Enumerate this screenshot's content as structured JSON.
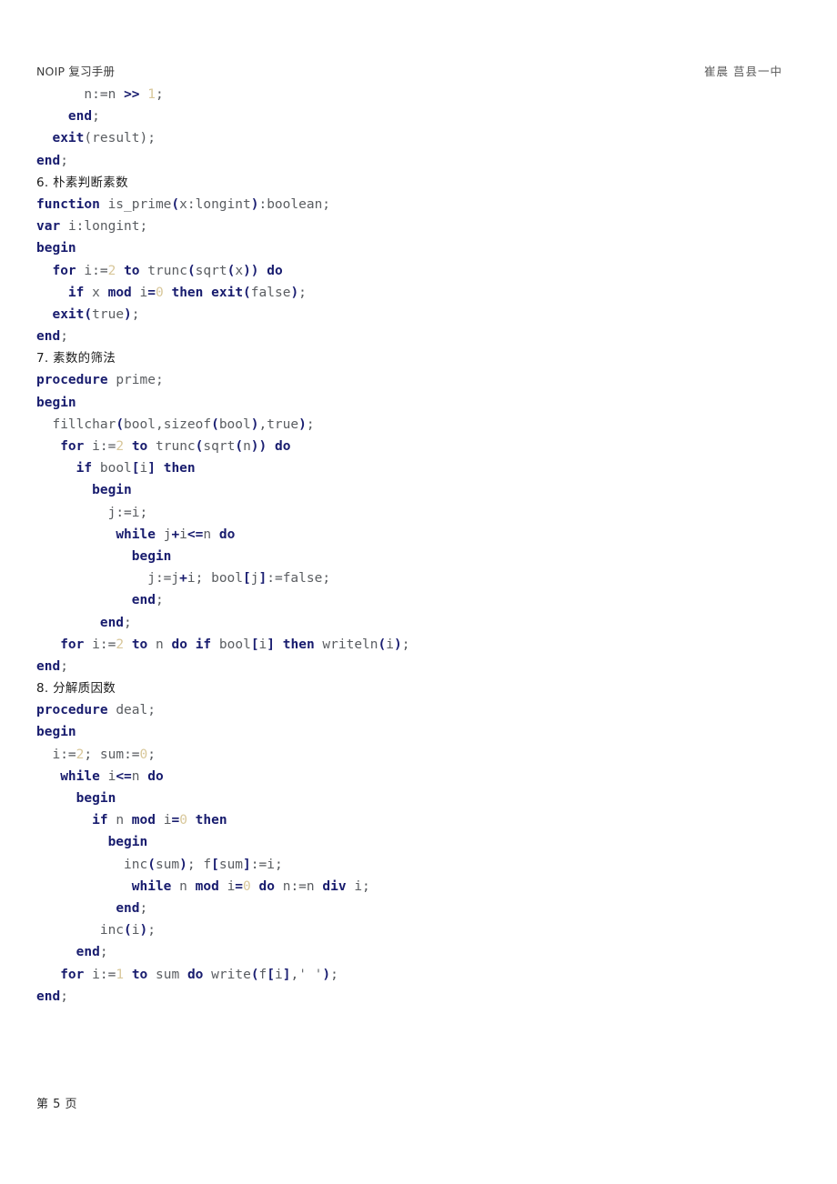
{
  "document": {
    "header_left": "NOIP 复习手册",
    "header_right": "崔晨  莒县一中",
    "footer": "第 5 页"
  },
  "code_lines": [
    {
      "indent": 6,
      "tokens": [
        {
          "t": "n",
          "c": "id"
        },
        {
          "t": ":=",
          "c": "punc"
        },
        {
          "t": "n",
          "c": "id"
        },
        {
          "t": " ",
          "c": "punc"
        },
        {
          "t": ">>",
          "c": "op"
        },
        {
          "t": " ",
          "c": "punc"
        },
        {
          "t": "1",
          "c": "num"
        },
        {
          "t": ";",
          "c": "punc"
        }
      ]
    },
    {
      "indent": 4,
      "tokens": [
        {
          "t": "end",
          "c": "kw"
        },
        {
          "t": ";",
          "c": "punc"
        }
      ]
    },
    {
      "indent": 2,
      "tokens": [
        {
          "t": "exit",
          "c": "kw"
        },
        {
          "t": "(",
          "c": "punc"
        },
        {
          "t": "result",
          "c": "id"
        },
        {
          "t": ")",
          "c": "punc"
        },
        {
          "t": ";",
          "c": "punc"
        }
      ]
    },
    {
      "indent": 0,
      "tokens": [
        {
          "t": "end",
          "c": "kw"
        },
        {
          "t": ";",
          "c": "punc"
        }
      ]
    },
    {
      "heading": true,
      "indent": 0,
      "text": "6. 朴素判断素数"
    },
    {
      "indent": 0,
      "tokens": [
        {
          "t": "function",
          "c": "kw"
        },
        {
          "t": " ",
          "c": "punc"
        },
        {
          "t": "is_prime",
          "c": "id"
        },
        {
          "t": "(",
          "c": "brk"
        },
        {
          "t": "x:longint",
          "c": "id"
        },
        {
          "t": ")",
          "c": "brk"
        },
        {
          "t": ":boolean;",
          "c": "id"
        }
      ]
    },
    {
      "indent": 0,
      "tokens": [
        {
          "t": "var",
          "c": "kw"
        },
        {
          "t": " ",
          "c": "punc"
        },
        {
          "t": "i:longint;",
          "c": "id"
        }
      ]
    },
    {
      "indent": 0,
      "tokens": [
        {
          "t": "begin",
          "c": "kw"
        }
      ]
    },
    {
      "indent": 2,
      "tokens": [
        {
          "t": "for",
          "c": "kw"
        },
        {
          "t": " ",
          "c": "punc"
        },
        {
          "t": "i",
          "c": "id"
        },
        {
          "t": ":=",
          "c": "punc"
        },
        {
          "t": "2",
          "c": "num"
        },
        {
          "t": " ",
          "c": "punc"
        },
        {
          "t": "to",
          "c": "kw"
        },
        {
          "t": " ",
          "c": "punc"
        },
        {
          "t": "trunc",
          "c": "id"
        },
        {
          "t": "(",
          "c": "brk"
        },
        {
          "t": "sqrt",
          "c": "id"
        },
        {
          "t": "(",
          "c": "brk"
        },
        {
          "t": "x",
          "c": "id"
        },
        {
          "t": ")",
          "c": "brk"
        },
        {
          "t": ")",
          "c": "brk"
        },
        {
          "t": " ",
          "c": "punc"
        },
        {
          "t": "do",
          "c": "kw"
        }
      ]
    },
    {
      "indent": 4,
      "tokens": [
        {
          "t": "if",
          "c": "kw"
        },
        {
          "t": " ",
          "c": "punc"
        },
        {
          "t": "x",
          "c": "id"
        },
        {
          "t": " ",
          "c": "punc"
        },
        {
          "t": "mod",
          "c": "kw"
        },
        {
          "t": " ",
          "c": "punc"
        },
        {
          "t": "i",
          "c": "id"
        },
        {
          "t": "=",
          "c": "op"
        },
        {
          "t": "0",
          "c": "num"
        },
        {
          "t": " ",
          "c": "punc"
        },
        {
          "t": "then",
          "c": "kw"
        },
        {
          "t": " ",
          "c": "punc"
        },
        {
          "t": "exit",
          "c": "kw"
        },
        {
          "t": "(",
          "c": "brk"
        },
        {
          "t": "false",
          "c": "id"
        },
        {
          "t": ")",
          "c": "brk"
        },
        {
          "t": ";",
          "c": "punc"
        }
      ]
    },
    {
      "indent": 2,
      "tokens": [
        {
          "t": "exit",
          "c": "kw"
        },
        {
          "t": "(",
          "c": "brk"
        },
        {
          "t": "true",
          "c": "id"
        },
        {
          "t": ")",
          "c": "brk"
        },
        {
          "t": ";",
          "c": "punc"
        }
      ]
    },
    {
      "indent": 0,
      "tokens": [
        {
          "t": "end",
          "c": "kw"
        },
        {
          "t": ";",
          "c": "punc"
        }
      ]
    },
    {
      "heading": true,
      "indent": 0,
      "text": "7. 素数的筛法"
    },
    {
      "indent": 0,
      "tokens": [
        {
          "t": "procedure",
          "c": "kw"
        },
        {
          "t": " ",
          "c": "punc"
        },
        {
          "t": "prime;",
          "c": "id"
        }
      ]
    },
    {
      "indent": 0,
      "tokens": [
        {
          "t": "begin",
          "c": "kw"
        }
      ]
    },
    {
      "indent": 2,
      "tokens": [
        {
          "t": "fillchar",
          "c": "id"
        },
        {
          "t": "(",
          "c": "brk"
        },
        {
          "t": "bool,sizeof",
          "c": "id"
        },
        {
          "t": "(",
          "c": "brk"
        },
        {
          "t": "bool",
          "c": "id"
        },
        {
          "t": ")",
          "c": "brk"
        },
        {
          "t": ",",
          "c": "punc"
        },
        {
          "t": "true",
          "c": "id"
        },
        {
          "t": ")",
          "c": "brk"
        },
        {
          "t": ";",
          "c": "punc"
        }
      ]
    },
    {
      "indent": 3,
      "tokens": [
        {
          "t": "for",
          "c": "kw"
        },
        {
          "t": " ",
          "c": "punc"
        },
        {
          "t": "i",
          "c": "id"
        },
        {
          "t": ":=",
          "c": "punc"
        },
        {
          "t": "2",
          "c": "num"
        },
        {
          "t": " ",
          "c": "punc"
        },
        {
          "t": "to",
          "c": "kw"
        },
        {
          "t": " ",
          "c": "punc"
        },
        {
          "t": "trunc",
          "c": "id"
        },
        {
          "t": "(",
          "c": "brk"
        },
        {
          "t": "sqrt",
          "c": "id"
        },
        {
          "t": "(",
          "c": "brk"
        },
        {
          "t": "n",
          "c": "id"
        },
        {
          "t": ")",
          "c": "brk"
        },
        {
          "t": ")",
          "c": "brk"
        },
        {
          "t": " ",
          "c": "punc"
        },
        {
          "t": "do",
          "c": "kw"
        }
      ]
    },
    {
      "indent": 5,
      "tokens": [
        {
          "t": "if",
          "c": "kw"
        },
        {
          "t": " ",
          "c": "punc"
        },
        {
          "t": "bool",
          "c": "id"
        },
        {
          "t": "[",
          "c": "brk"
        },
        {
          "t": "i",
          "c": "id"
        },
        {
          "t": "]",
          "c": "brk"
        },
        {
          "t": " ",
          "c": "punc"
        },
        {
          "t": "then",
          "c": "kw"
        }
      ]
    },
    {
      "indent": 7,
      "tokens": [
        {
          "t": "begin",
          "c": "kw"
        }
      ]
    },
    {
      "indent": 9,
      "tokens": [
        {
          "t": "j",
          "c": "id"
        },
        {
          "t": ":=",
          "c": "punc"
        },
        {
          "t": "i",
          "c": "id"
        },
        {
          "t": ";",
          "c": "punc"
        }
      ]
    },
    {
      "indent": 10,
      "tokens": [
        {
          "t": "while",
          "c": "kw"
        },
        {
          "t": " ",
          "c": "punc"
        },
        {
          "t": "j",
          "c": "id"
        },
        {
          "t": "+",
          "c": "op"
        },
        {
          "t": "i",
          "c": "id"
        },
        {
          "t": "<=",
          "c": "op"
        },
        {
          "t": "n",
          "c": "id"
        },
        {
          "t": " ",
          "c": "punc"
        },
        {
          "t": "do",
          "c": "kw"
        }
      ]
    },
    {
      "indent": 12,
      "tokens": [
        {
          "t": "begin",
          "c": "kw"
        }
      ]
    },
    {
      "indent": 14,
      "tokens": [
        {
          "t": "j",
          "c": "id"
        },
        {
          "t": ":=",
          "c": "punc"
        },
        {
          "t": "j",
          "c": "id"
        },
        {
          "t": "+",
          "c": "op"
        },
        {
          "t": "i",
          "c": "id"
        },
        {
          "t": ";",
          "c": "punc"
        },
        {
          "t": " ",
          "c": "punc"
        },
        {
          "t": "bool",
          "c": "id"
        },
        {
          "t": "[",
          "c": "brk"
        },
        {
          "t": "j",
          "c": "id"
        },
        {
          "t": "]",
          "c": "brk"
        },
        {
          "t": ":=",
          "c": "punc"
        },
        {
          "t": "false",
          "c": "id"
        },
        {
          "t": ";",
          "c": "punc"
        }
      ]
    },
    {
      "indent": 12,
      "tokens": [
        {
          "t": "end",
          "c": "kw"
        },
        {
          "t": ";",
          "c": "punc"
        }
      ]
    },
    {
      "indent": 8,
      "tokens": [
        {
          "t": "end",
          "c": "kw"
        },
        {
          "t": ";",
          "c": "punc"
        }
      ]
    },
    {
      "indent": 3,
      "tokens": [
        {
          "t": "for",
          "c": "kw"
        },
        {
          "t": " ",
          "c": "punc"
        },
        {
          "t": "i",
          "c": "id"
        },
        {
          "t": ":=",
          "c": "punc"
        },
        {
          "t": "2",
          "c": "num"
        },
        {
          "t": " ",
          "c": "punc"
        },
        {
          "t": "to",
          "c": "kw"
        },
        {
          "t": " ",
          "c": "punc"
        },
        {
          "t": "n",
          "c": "id"
        },
        {
          "t": " ",
          "c": "punc"
        },
        {
          "t": "do",
          "c": "kw"
        },
        {
          "t": " ",
          "c": "punc"
        },
        {
          "t": "if",
          "c": "kw"
        },
        {
          "t": " ",
          "c": "punc"
        },
        {
          "t": "bool",
          "c": "id"
        },
        {
          "t": "[",
          "c": "brk"
        },
        {
          "t": "i",
          "c": "id"
        },
        {
          "t": "]",
          "c": "brk"
        },
        {
          "t": " ",
          "c": "punc"
        },
        {
          "t": "then",
          "c": "kw"
        },
        {
          "t": " ",
          "c": "punc"
        },
        {
          "t": "writeln",
          "c": "id"
        },
        {
          "t": "(",
          "c": "brk"
        },
        {
          "t": "i",
          "c": "id"
        },
        {
          "t": ")",
          "c": "brk"
        },
        {
          "t": ";",
          "c": "punc"
        }
      ]
    },
    {
      "indent": 0,
      "tokens": [
        {
          "t": "end",
          "c": "kw"
        },
        {
          "t": ";",
          "c": "punc"
        }
      ]
    },
    {
      "heading": true,
      "indent": 0,
      "text": "8. 分解质因数"
    },
    {
      "indent": 0,
      "tokens": [
        {
          "t": "procedure",
          "c": "kw"
        },
        {
          "t": " ",
          "c": "punc"
        },
        {
          "t": "deal;",
          "c": "id"
        }
      ]
    },
    {
      "indent": 0,
      "tokens": [
        {
          "t": "begin",
          "c": "kw"
        }
      ]
    },
    {
      "indent": 2,
      "tokens": [
        {
          "t": "i",
          "c": "id"
        },
        {
          "t": ":=",
          "c": "punc"
        },
        {
          "t": "2",
          "c": "num"
        },
        {
          "t": ";",
          "c": "punc"
        },
        {
          "t": " ",
          "c": "punc"
        },
        {
          "t": "sum",
          "c": "id"
        },
        {
          "t": ":=",
          "c": "punc"
        },
        {
          "t": "0",
          "c": "num"
        },
        {
          "t": ";",
          "c": "punc"
        }
      ]
    },
    {
      "indent": 3,
      "tokens": [
        {
          "t": "while",
          "c": "kw"
        },
        {
          "t": " ",
          "c": "punc"
        },
        {
          "t": "i",
          "c": "id"
        },
        {
          "t": "<=",
          "c": "op"
        },
        {
          "t": "n",
          "c": "id"
        },
        {
          "t": " ",
          "c": "punc"
        },
        {
          "t": "do",
          "c": "kw"
        }
      ]
    },
    {
      "indent": 5,
      "tokens": [
        {
          "t": "begin",
          "c": "kw"
        }
      ]
    },
    {
      "indent": 7,
      "tokens": [
        {
          "t": "if",
          "c": "kw"
        },
        {
          "t": " ",
          "c": "punc"
        },
        {
          "t": "n",
          "c": "id"
        },
        {
          "t": " ",
          "c": "punc"
        },
        {
          "t": "mod",
          "c": "kw"
        },
        {
          "t": " ",
          "c": "punc"
        },
        {
          "t": "i",
          "c": "id"
        },
        {
          "t": "=",
          "c": "op"
        },
        {
          "t": "0",
          "c": "num"
        },
        {
          "t": " ",
          "c": "punc"
        },
        {
          "t": "then",
          "c": "kw"
        }
      ]
    },
    {
      "indent": 9,
      "tokens": [
        {
          "t": "begin",
          "c": "kw"
        }
      ]
    },
    {
      "indent": 11,
      "tokens": [
        {
          "t": "inc",
          "c": "id"
        },
        {
          "t": "(",
          "c": "brk"
        },
        {
          "t": "sum",
          "c": "id"
        },
        {
          "t": ")",
          "c": "brk"
        },
        {
          "t": ";",
          "c": "punc"
        },
        {
          "t": " ",
          "c": "punc"
        },
        {
          "t": "f",
          "c": "id"
        },
        {
          "t": "[",
          "c": "brk"
        },
        {
          "t": "sum",
          "c": "id"
        },
        {
          "t": "]",
          "c": "brk"
        },
        {
          "t": ":=",
          "c": "punc"
        },
        {
          "t": "i",
          "c": "id"
        },
        {
          "t": ";",
          "c": "punc"
        }
      ]
    },
    {
      "indent": 12,
      "tokens": [
        {
          "t": "while",
          "c": "kw"
        },
        {
          "t": " ",
          "c": "punc"
        },
        {
          "t": "n",
          "c": "id"
        },
        {
          "t": " ",
          "c": "punc"
        },
        {
          "t": "mod",
          "c": "kw"
        },
        {
          "t": " ",
          "c": "punc"
        },
        {
          "t": "i",
          "c": "id"
        },
        {
          "t": "=",
          "c": "op"
        },
        {
          "t": "0",
          "c": "num"
        },
        {
          "t": " ",
          "c": "punc"
        },
        {
          "t": "do",
          "c": "kw"
        },
        {
          "t": " ",
          "c": "punc"
        },
        {
          "t": "n",
          "c": "id"
        },
        {
          "t": ":=",
          "c": "punc"
        },
        {
          "t": "n",
          "c": "id"
        },
        {
          "t": " ",
          "c": "punc"
        },
        {
          "t": "div",
          "c": "kw"
        },
        {
          "t": " ",
          "c": "punc"
        },
        {
          "t": "i",
          "c": "id"
        },
        {
          "t": ";",
          "c": "punc"
        }
      ]
    },
    {
      "indent": 10,
      "tokens": [
        {
          "t": "end",
          "c": "kw"
        },
        {
          "t": ";",
          "c": "punc"
        }
      ]
    },
    {
      "indent": 8,
      "tokens": [
        {
          "t": "inc",
          "c": "id"
        },
        {
          "t": "(",
          "c": "brk"
        },
        {
          "t": "i",
          "c": "id"
        },
        {
          "t": ")",
          "c": "brk"
        },
        {
          "t": ";",
          "c": "punc"
        }
      ]
    },
    {
      "indent": 5,
      "tokens": [
        {
          "t": "end",
          "c": "kw"
        },
        {
          "t": ";",
          "c": "punc"
        }
      ]
    },
    {
      "indent": 3,
      "tokens": [
        {
          "t": "for",
          "c": "kw"
        },
        {
          "t": " ",
          "c": "punc"
        },
        {
          "t": "i",
          "c": "id"
        },
        {
          "t": ":=",
          "c": "punc"
        },
        {
          "t": "1",
          "c": "num"
        },
        {
          "t": " ",
          "c": "punc"
        },
        {
          "t": "to",
          "c": "kw"
        },
        {
          "t": " ",
          "c": "punc"
        },
        {
          "t": "sum",
          "c": "id"
        },
        {
          "t": " ",
          "c": "punc"
        },
        {
          "t": "do",
          "c": "kw"
        },
        {
          "t": " ",
          "c": "punc"
        },
        {
          "t": "write",
          "c": "id"
        },
        {
          "t": "(",
          "c": "brk"
        },
        {
          "t": "f",
          "c": "id"
        },
        {
          "t": "[",
          "c": "brk"
        },
        {
          "t": "i",
          "c": "id"
        },
        {
          "t": "]",
          "c": "brk"
        },
        {
          "t": ",",
          "c": "punc"
        },
        {
          "t": "' '",
          "c": "str"
        },
        {
          "t": ")",
          "c": "brk"
        },
        {
          "t": ";",
          "c": "punc"
        }
      ]
    },
    {
      "indent": 0,
      "tokens": [
        {
          "t": "end",
          "c": "kw"
        },
        {
          "t": ";",
          "c": "punc"
        }
      ]
    }
  ]
}
